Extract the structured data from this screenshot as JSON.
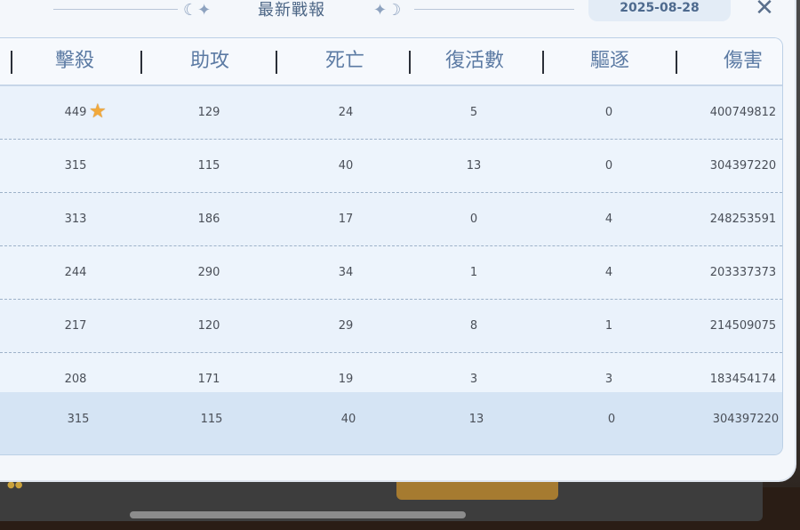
{
  "window": {
    "title": "最新戰報",
    "date": "2025-08-28",
    "close_icon": "close-icon"
  },
  "columns": [
    "擊殺",
    "助攻",
    "死亡",
    "復活數",
    "驅逐",
    "傷害"
  ],
  "rows": [
    {
      "kills": "449",
      "assists": "129",
      "deaths": "24",
      "revives": "5",
      "expels": "0",
      "damage": "400749812",
      "mvp": true
    },
    {
      "kills": "315",
      "assists": "115",
      "deaths": "40",
      "revives": "13",
      "expels": "0",
      "damage": "304397220"
    },
    {
      "kills": "313",
      "assists": "186",
      "deaths": "17",
      "revives": "0",
      "expels": "4",
      "damage": "248253591"
    },
    {
      "kills": "244",
      "assists": "290",
      "deaths": "34",
      "revives": "1",
      "expels": "4",
      "damage": "203337373"
    },
    {
      "kills": "217",
      "assists": "120",
      "deaths": "29",
      "revives": "8",
      "expels": "1",
      "damage": "214509075"
    },
    {
      "kills": "208",
      "assists": "171",
      "deaths": "19",
      "revives": "3",
      "expels": "3",
      "damage": "183454174"
    }
  ],
  "self_row": {
    "kills": "315",
    "assists": "115",
    "deaths": "40",
    "revives": "13",
    "expels": "0",
    "damage": "304397220"
  },
  "colors": {
    "accent": "#5b7aa3",
    "star": "#f2a93b",
    "panel": "#e9f1fa"
  }
}
